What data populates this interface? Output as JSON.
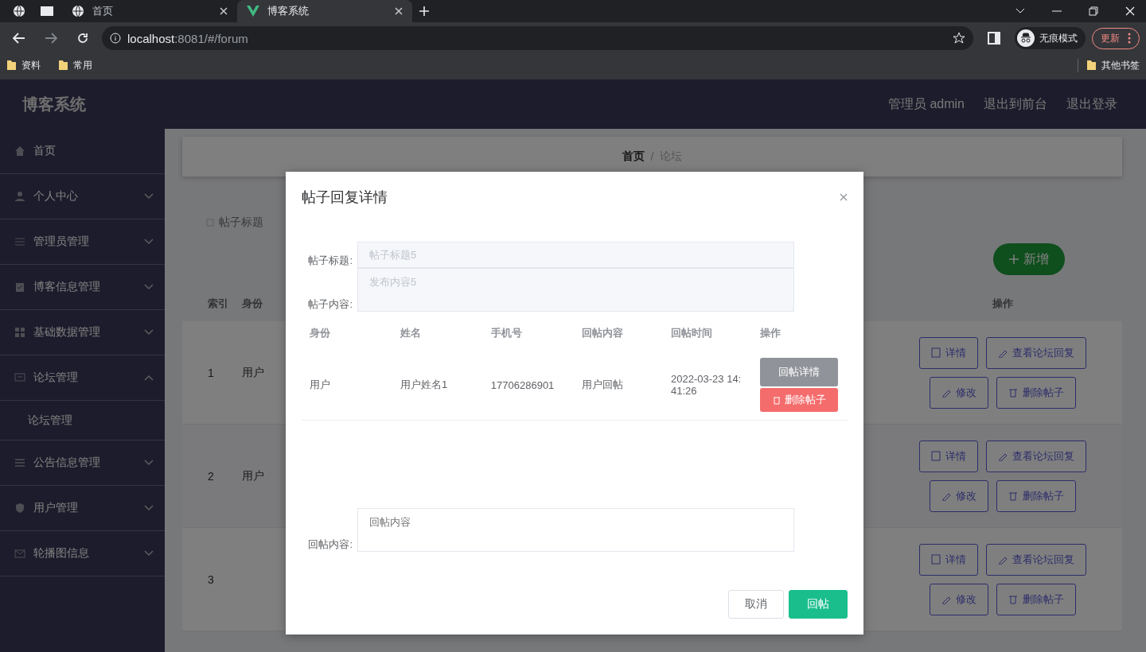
{
  "browser": {
    "tabs": [
      {
        "title": "首页",
        "selected": false
      },
      {
        "title": "博客系统",
        "selected": true
      }
    ],
    "address": {
      "host": "localhost",
      "path": ":8081/#/forum"
    },
    "profile": "无痕模式",
    "update_button": "更新",
    "bookmarks": [
      "资料",
      "常用"
    ],
    "other_bookmarks": "其他书签"
  },
  "app": {
    "title": "博客系统",
    "header_links": [
      "管理员 admin",
      "退出到前台",
      "退出登录"
    ]
  },
  "sidebar": {
    "items": [
      {
        "label": "首页",
        "kind": "link"
      },
      {
        "label": "个人中心",
        "kind": "group",
        "expanded": false
      },
      {
        "label": "管理员管理",
        "kind": "group",
        "expanded": false
      },
      {
        "label": "博客信息管理",
        "kind": "group",
        "expanded": false
      },
      {
        "label": "基础数据管理",
        "kind": "group",
        "expanded": false
      },
      {
        "label": "论坛管理",
        "kind": "group",
        "expanded": true,
        "children": [
          {
            "label": "论坛管理"
          }
        ]
      },
      {
        "label": "公告信息管理",
        "kind": "group",
        "expanded": false
      },
      {
        "label": "用户管理",
        "kind": "group",
        "expanded": false
      },
      {
        "label": "轮播图信息",
        "kind": "group",
        "expanded": false
      }
    ]
  },
  "breadcrumb": {
    "items": [
      "首页",
      "论坛"
    ],
    "separator": "/"
  },
  "search": {
    "placeholder": "帖子标题"
  },
  "add_button": "新增",
  "table": {
    "columns": [
      "索引",
      "身份",
      "操作"
    ],
    "rows": [
      {
        "index": "1",
        "identity": "用户",
        "actions": [
          "详情",
          "查看论坛回复",
          "修改",
          "删除帖子"
        ]
      },
      {
        "index": "2",
        "identity": "用户",
        "actions": [
          "详情",
          "查看论坛回复",
          "修改",
          "删除帖子"
        ]
      },
      {
        "index": "3",
        "actions": [
          "详情",
          "查看论坛回复",
          "修改",
          "删除帖子"
        ]
      }
    ]
  },
  "dialog": {
    "title": "帖子回复详情",
    "fields": [
      {
        "label": "帖子标题:",
        "value": "帖子标题5",
        "disabled": true,
        "kind": "input"
      },
      {
        "label": "帖子内容:",
        "value": "发布内容5",
        "disabled": true,
        "kind": "textarea"
      }
    ],
    "replies": {
      "columns": [
        "身份",
        "姓名",
        "手机号",
        "回帖内容",
        "回帖时间",
        "操作"
      ],
      "rows": [
        {
          "cells": [
            "用户",
            "用户姓名1",
            "17706286901",
            "用户回帖",
            "2022-03-23 14:41:26"
          ],
          "actions": [
            "回帖详情",
            "删除帖子"
          ]
        }
      ]
    },
    "reply_field": {
      "label": "回帖内容:",
      "placeholder": "回帖内容"
    },
    "buttons": [
      "取消",
      "回帖"
    ]
  }
}
